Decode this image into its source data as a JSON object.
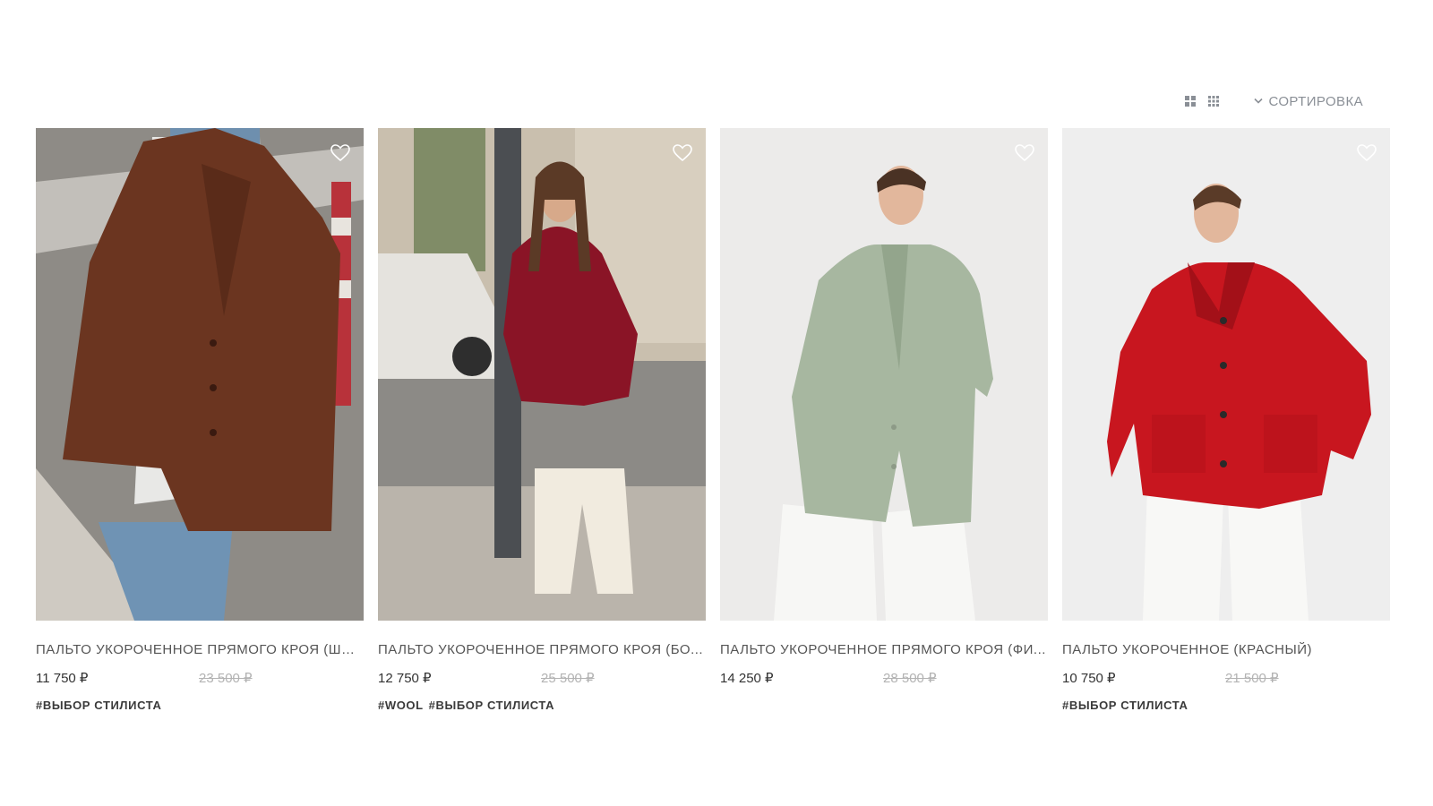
{
  "toolbar": {
    "view_small_icon": "grid-2x2-icon",
    "view_large_icon": "grid-3x3-icon",
    "sort_label": "СОРТИРОВКА",
    "sort_icon": "chevron-down-icon"
  },
  "products": [
    {
      "title": "ПАЛЬТО УКОРОЧЕННОЕ ПРЯМОГО КРОЯ (ШО...",
      "price": "11 750 ₽",
      "old_price": "23 500 ₽",
      "tags": [
        "#ВЫБОР СТИЛИСТА"
      ],
      "coat_color": "#6b3520",
      "background": "#8c8a86"
    },
    {
      "title": "ПАЛЬТО УКОРОЧЕННОЕ ПРЯМОГО КРОЯ (БО...",
      "price": "12 750 ₽",
      "old_price": "25 500 ₽",
      "tags": [
        "#WOOL",
        "#ВЫБОР СТИЛИСТА"
      ],
      "coat_color": "#8a1426",
      "background": "#a69a8a"
    },
    {
      "title": "ПАЛЬТО УКОРОЧЕННОЕ ПРЯМОГО КРОЯ (ФИ...",
      "price": "14 250 ₽",
      "old_price": "28 500 ₽",
      "tags": [],
      "coat_color": "#a7b7a0",
      "background": "#ecebea"
    },
    {
      "title": "ПАЛЬТО УКОРОЧЕННОЕ (КРАСНЫЙ)",
      "price": "10 750 ₽",
      "old_price": "21 500 ₽",
      "tags": [
        "#ВЫБОР СТИЛИСТА"
      ],
      "coat_color": "#c8161f",
      "background": "#eeeeee"
    }
  ],
  "favorite_icon": "heart-outline-icon"
}
